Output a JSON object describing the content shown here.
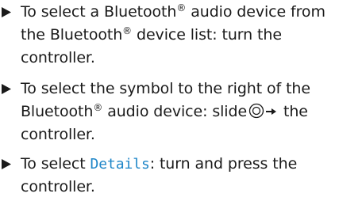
{
  "steps": [
    {
      "lines": [
        {
          "text": "To select a Bluetooth",
          "reg": "®",
          "after": " audio device from"
        },
        {
          "text": "the Bluetooth",
          "reg": "®",
          "after": " device list: turn the"
        },
        {
          "text": "controller."
        }
      ]
    },
    {
      "lines": [
        {
          "text": "To select the symbol to the right of the"
        },
        {
          "text": "Bluetooth",
          "reg": "®",
          "after": " audio device: slide",
          "after2": " the"
        },
        {
          "text": "controller."
        }
      ],
      "slide_icon": "slide-right-icon"
    },
    {
      "lines": [
        {
          "before": "To select ",
          "menu": "Details",
          "after": ": turn and press the"
        },
        {
          "text": "controller."
        }
      ]
    }
  ],
  "colors": {
    "text": "#1a1a1a",
    "menu_item": "#1f86c8"
  },
  "bullet_icon": "triangle-bullet-icon"
}
